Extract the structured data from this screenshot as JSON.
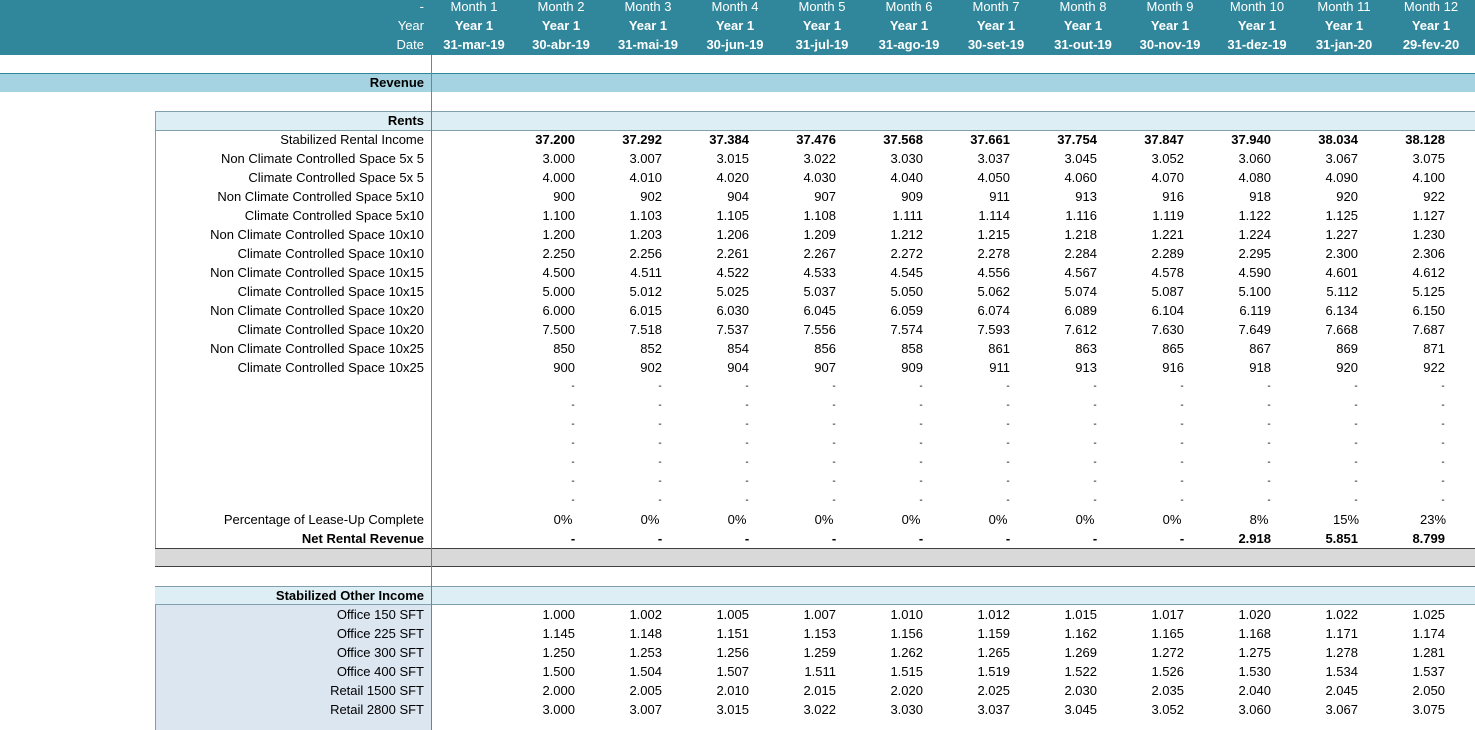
{
  "header": {
    "row0_label": "-",
    "year_label": "Year",
    "date_label": "Date",
    "months": [
      "Month 1",
      "Month 2",
      "Month 3",
      "Month 4",
      "Month 5",
      "Month 6",
      "Month 7",
      "Month 8",
      "Month 9",
      "Month 10",
      "Month 11",
      "Month 12"
    ],
    "years": [
      "Year 1",
      "Year 1",
      "Year 1",
      "Year 1",
      "Year 1",
      "Year 1",
      "Year 1",
      "Year 1",
      "Year 1",
      "Year 1",
      "Year 1",
      "Year 1"
    ],
    "dates": [
      "31-mar-19",
      "30-abr-19",
      "31-mai-19",
      "30-jun-19",
      "31-jul-19",
      "31-ago-19",
      "30-set-19",
      "31-out-19",
      "30-nov-19",
      "31-dez-19",
      "31-jan-20",
      "29-fev-20"
    ]
  },
  "revenue_title": "Revenue",
  "rents": {
    "title": "Rents",
    "rows": [
      {
        "label": "Stabilized Rental Income",
        "bold": true,
        "values": [
          "37.200",
          "37.292",
          "37.384",
          "37.476",
          "37.568",
          "37.661",
          "37.754",
          "37.847",
          "37.940",
          "38.034",
          "38.128"
        ]
      },
      {
        "label": "Non Climate Controlled Space  5x 5",
        "values": [
          "3.000",
          "3.007",
          "3.015",
          "3.022",
          "3.030",
          "3.037",
          "3.045",
          "3.052",
          "3.060",
          "3.067",
          "3.075"
        ]
      },
      {
        "label": "Climate Controlled Space  5x 5",
        "values": [
          "4.000",
          "4.010",
          "4.020",
          "4.030",
          "4.040",
          "4.050",
          "4.060",
          "4.070",
          "4.080",
          "4.090",
          "4.100"
        ]
      },
      {
        "label": "Non Climate Controlled Space  5x10",
        "values": [
          "900",
          "902",
          "904",
          "907",
          "909",
          "911",
          "913",
          "916",
          "918",
          "920",
          "922"
        ]
      },
      {
        "label": "Climate Controlled Space  5x10",
        "values": [
          "1.100",
          "1.103",
          "1.105",
          "1.108",
          "1.111",
          "1.114",
          "1.116",
          "1.119",
          "1.122",
          "1.125",
          "1.127"
        ]
      },
      {
        "label": "Non Climate Controlled Space  10x10",
        "values": [
          "1.200",
          "1.203",
          "1.206",
          "1.209",
          "1.212",
          "1.215",
          "1.218",
          "1.221",
          "1.224",
          "1.227",
          "1.230"
        ]
      },
      {
        "label": "Climate Controlled Space  10x10",
        "values": [
          "2.250",
          "2.256",
          "2.261",
          "2.267",
          "2.272",
          "2.278",
          "2.284",
          "2.289",
          "2.295",
          "2.300",
          "2.306"
        ]
      },
      {
        "label": "Non Climate Controlled Space  10x15",
        "values": [
          "4.500",
          "4.511",
          "4.522",
          "4.533",
          "4.545",
          "4.556",
          "4.567",
          "4.578",
          "4.590",
          "4.601",
          "4.612"
        ]
      },
      {
        "label": "Climate Controlled Space  10x15",
        "values": [
          "5.000",
          "5.012",
          "5.025",
          "5.037",
          "5.050",
          "5.062",
          "5.074",
          "5.087",
          "5.100",
          "5.112",
          "5.125"
        ]
      },
      {
        "label": "Non Climate Controlled Space  10x20",
        "values": [
          "6.000",
          "6.015",
          "6.030",
          "6.045",
          "6.059",
          "6.074",
          "6.089",
          "6.104",
          "6.119",
          "6.134",
          "6.150"
        ]
      },
      {
        "label": "Climate Controlled Space  10x20",
        "values": [
          "7.500",
          "7.518",
          "7.537",
          "7.556",
          "7.574",
          "7.593",
          "7.612",
          "7.630",
          "7.649",
          "7.668",
          "7.687"
        ]
      },
      {
        "label": "Non Climate Controlled Space  10x25",
        "values": [
          "850",
          "852",
          "854",
          "856",
          "858",
          "861",
          "863",
          "865",
          "867",
          "869",
          "871"
        ]
      },
      {
        "label": "Climate Controlled Space  10x25",
        "values": [
          "900",
          "902",
          "904",
          "907",
          "909",
          "911",
          "913",
          "916",
          "918",
          "920",
          "922"
        ]
      },
      {
        "label": "",
        "values": [
          "-",
          "-",
          "-",
          "-",
          "-",
          "-",
          "-",
          "-",
          "-",
          "-",
          "-"
        ]
      },
      {
        "label": "",
        "values": [
          "-",
          "-",
          "-",
          "-",
          "-",
          "-",
          "-",
          "-",
          "-",
          "-",
          "-"
        ]
      },
      {
        "label": "",
        "values": [
          "-",
          "-",
          "-",
          "-",
          "-",
          "-",
          "-",
          "-",
          "-",
          "-",
          "-"
        ]
      },
      {
        "label": "",
        "values": [
          "-",
          "-",
          "-",
          "-",
          "-",
          "-",
          "-",
          "-",
          "-",
          "-",
          "-"
        ]
      },
      {
        "label": "",
        "values": [
          "-",
          "-",
          "-",
          "-",
          "-",
          "-",
          "-",
          "-",
          "-",
          "-",
          "-"
        ]
      },
      {
        "label": "",
        "values": [
          "-",
          "-",
          "-",
          "-",
          "-",
          "-",
          "-",
          "-",
          "-",
          "-",
          "-"
        ]
      },
      {
        "label": "",
        "values": [
          "-",
          "-",
          "-",
          "-",
          "-",
          "-",
          "-",
          "-",
          "-",
          "-",
          "-"
        ]
      },
      {
        "label": "Percentage of Lease-Up Complete",
        "values": [
          "0%",
          "0%",
          "0%",
          "0%",
          "0%",
          "0%",
          "0%",
          "0%",
          "8%",
          "15%",
          "23%"
        ]
      },
      {
        "label": "Net Rental Revenue",
        "bold": true,
        "total": true,
        "values": [
          "-",
          "-",
          "-",
          "-",
          "-",
          "-",
          "-",
          "-",
          "2.918",
          "5.851",
          "8.799"
        ]
      }
    ]
  },
  "other_income": {
    "title": "Stabilized Other Income",
    "rows": [
      {
        "label": "Office 150 SFT",
        "values": [
          "1.000",
          "1.002",
          "1.005",
          "1.007",
          "1.010",
          "1.012",
          "1.015",
          "1.017",
          "1.020",
          "1.022",
          "1.025"
        ]
      },
      {
        "label": "Office 225 SFT",
        "values": [
          "1.145",
          "1.148",
          "1.151",
          "1.153",
          "1.156",
          "1.159",
          "1.162",
          "1.165",
          "1.168",
          "1.171",
          "1.174"
        ]
      },
      {
        "label": "Office 300 SFT",
        "values": [
          "1.250",
          "1.253",
          "1.256",
          "1.259",
          "1.262",
          "1.265",
          "1.269",
          "1.272",
          "1.275",
          "1.278",
          "1.281"
        ]
      },
      {
        "label": "Office 400 SFT",
        "values": [
          "1.500",
          "1.504",
          "1.507",
          "1.511",
          "1.515",
          "1.519",
          "1.522",
          "1.526",
          "1.530",
          "1.534",
          "1.537"
        ]
      },
      {
        "label": "Retail 1500 SFT",
        "values": [
          "2.000",
          "2.005",
          "2.010",
          "2.015",
          "2.020",
          "2.025",
          "2.030",
          "2.035",
          "2.040",
          "2.045",
          "2.050"
        ]
      },
      {
        "label": "Retail 2800 SFT",
        "values": [
          "3.000",
          "3.007",
          "3.015",
          "3.022",
          "3.030",
          "3.037",
          "3.045",
          "3.052",
          "3.060",
          "3.067",
          "3.075"
        ]
      }
    ]
  },
  "colors": {
    "header_bg": "#30869a",
    "section_band": "#a6d3e1",
    "subsection_band": "#ddeef4",
    "total_band": "#d9d9d9",
    "other_label_bg": "#dce6f1"
  }
}
